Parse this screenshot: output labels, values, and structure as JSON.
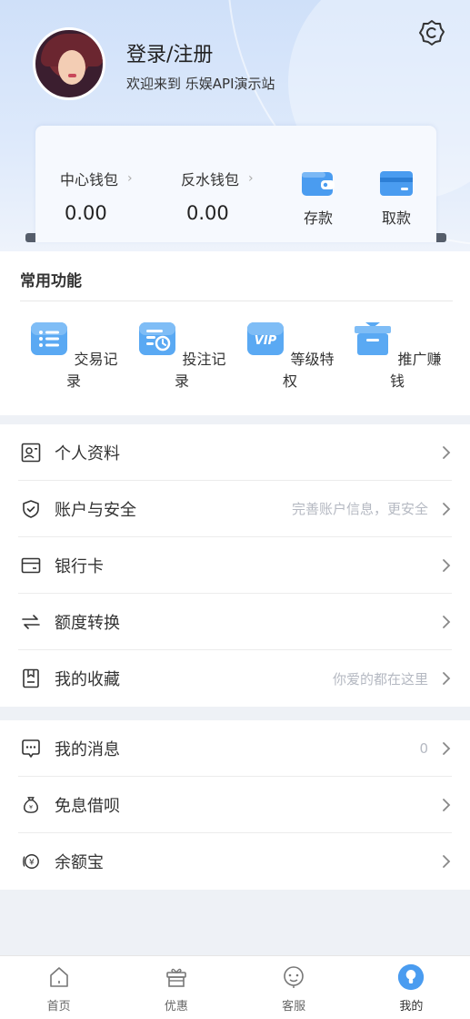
{
  "header": {
    "login_title": "登录/注册",
    "welcome_text": "欢迎来到 乐娱API演示站"
  },
  "wallet": {
    "center": {
      "label": "中心钱包",
      "amount": "0.00"
    },
    "rebate": {
      "label": "反水钱包",
      "amount": "0.00"
    },
    "deposit_label": "存款",
    "withdraw_label": "取款"
  },
  "common": {
    "title": "常用功能",
    "items": [
      {
        "label": "交易记录",
        "icon": "list-icon"
      },
      {
        "label": "投注记录",
        "icon": "bet-record-icon"
      },
      {
        "label": "等级特权",
        "icon": "vip-icon"
      },
      {
        "label": "推广赚钱",
        "icon": "gift-icon"
      }
    ]
  },
  "menu_group1": [
    {
      "label": "个人资料",
      "hint": "",
      "icon": "profile-card-icon"
    },
    {
      "label": "账户与安全",
      "hint": "完善账户信息，更安全",
      "icon": "shield-icon"
    },
    {
      "label": "银行卡",
      "hint": "",
      "icon": "bank-card-icon"
    },
    {
      "label": "额度转换",
      "hint": "",
      "icon": "transfer-icon"
    },
    {
      "label": "我的收藏",
      "hint": "你爱的都在这里",
      "icon": "bookmark-icon"
    }
  ],
  "menu_group2": [
    {
      "label": "我的消息",
      "hint": "0",
      "icon": "message-icon"
    },
    {
      "label": "免息借呗",
      "hint": "",
      "icon": "money-bag-icon"
    },
    {
      "label": "余额宝",
      "hint": "",
      "icon": "yen-coin-icon"
    }
  ],
  "tabbar": [
    {
      "label": "首页",
      "icon": "home-icon"
    },
    {
      "label": "优惠",
      "icon": "gift-box-icon"
    },
    {
      "label": "客服",
      "icon": "support-icon"
    },
    {
      "label": "我的",
      "icon": "user-icon"
    }
  ],
  "colors": {
    "accent_blue": "#4a9cf0",
    "header_bg": "#cfe0f9",
    "hint_gray": "#b5b9c2"
  }
}
